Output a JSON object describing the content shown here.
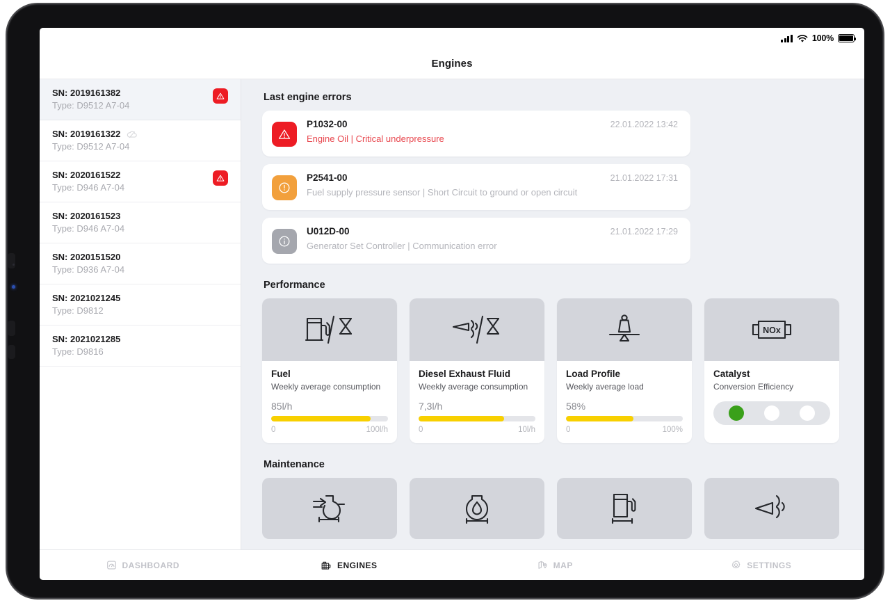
{
  "statusbar": {
    "battery_percent": "100%",
    "signal_icon": "signal-bars-icon",
    "wifi_icon": "wifi-icon",
    "battery_icon": "battery-full-icon"
  },
  "header": {
    "title": "Engines"
  },
  "sidebar": {
    "engines": [
      {
        "sn": "SN: 2019161382",
        "type": "Type: D9512 A7-04",
        "selected": true,
        "alert": true,
        "cloud_off": false
      },
      {
        "sn": "SN: 2019161322",
        "type": "Type: D9512 A7-04",
        "selected": false,
        "alert": false,
        "cloud_off": true
      },
      {
        "sn": "SN: 2020161522",
        "type": "Type: D946 A7-04",
        "selected": false,
        "alert": true,
        "cloud_off": false
      },
      {
        "sn": "SN: 2020161523",
        "type": "Type: D946 A7-04",
        "selected": false,
        "alert": false,
        "cloud_off": false
      },
      {
        "sn": "SN: 2020151520",
        "type": "Type: D936 A7-04",
        "selected": false,
        "alert": false,
        "cloud_off": false
      },
      {
        "sn": "SN: 2021021245",
        "type": "Type: D9812",
        "selected": false,
        "alert": false,
        "cloud_off": false
      },
      {
        "sn": "SN: 2021021285",
        "type": "Type: D9816",
        "selected": false,
        "alert": false,
        "cloud_off": false
      }
    ]
  },
  "errors": {
    "section_title": "Last engine errors",
    "items": [
      {
        "code": "P1032-00",
        "description": "Engine Oil | Critical underpressure",
        "timestamp": "22.01.2022  13:42",
        "severity": "critical",
        "icon": "warning-triangle-icon",
        "color": "#ed1c24"
      },
      {
        "code": "P2541-00",
        "description": "Fuel supply pressure sensor | Short Circuit to ground or open circuit",
        "timestamp": "21.01.2022  17:31",
        "severity": "warning",
        "icon": "exclamation-circle-icon",
        "color": "#f2a03c"
      },
      {
        "code": "U012D-00",
        "description": "Generator Set Controller | Communication error",
        "timestamp": "21.01.2022  17:29",
        "severity": "info",
        "icon": "info-circle-icon",
        "color": "#a5a7ae"
      }
    ]
  },
  "performance": {
    "section_title": "Performance",
    "cards": [
      {
        "name": "Fuel",
        "subtitle": "Weekly average consumption",
        "value": "85l/h",
        "scale_min": "0",
        "scale_max": "100l/h",
        "fill_percent": 85,
        "icon": "fuel-pump-per-hour-icon",
        "bar_color": "#f8d000"
      },
      {
        "name": "Diesel Exhaust Fluid",
        "subtitle": "Weekly average consumption",
        "value": "7,3l/h",
        "scale_min": "0",
        "scale_max": "10l/h",
        "fill_percent": 73,
        "icon": "exhaust-per-hour-icon",
        "bar_color": "#f8d000"
      },
      {
        "name": "Load Profile",
        "subtitle": "Weekly average load",
        "value": "58%",
        "scale_min": "0",
        "scale_max": "100%",
        "fill_percent": 58,
        "icon": "weight-scale-icon",
        "bar_color": "#f8d000"
      },
      {
        "name": "Catalyst",
        "subtitle": "Conversion Efficiency",
        "icon": "nox-catalyst-icon",
        "indicator": {
          "type": "dots",
          "count": 3,
          "active_index": 0,
          "active_color": "#3aa01a"
        }
      }
    ]
  },
  "maintenance": {
    "section_title": "Maintenance",
    "cards": [
      {
        "icon": "air-filter-service-icon"
      },
      {
        "icon": "oil-drop-service-icon"
      },
      {
        "icon": "fuel-filter-service-icon"
      },
      {
        "icon": "exhaust-service-icon"
      }
    ]
  },
  "bottomnav": {
    "items": [
      {
        "label": "DASHBOARD",
        "icon": "gauge-icon",
        "active": false
      },
      {
        "label": "ENGINES",
        "icon": "engine-icon",
        "active": true
      },
      {
        "label": "MAP",
        "icon": "map-pin-icon",
        "active": false
      },
      {
        "label": "SETTINGS",
        "icon": "gear-icon",
        "active": false
      }
    ]
  }
}
